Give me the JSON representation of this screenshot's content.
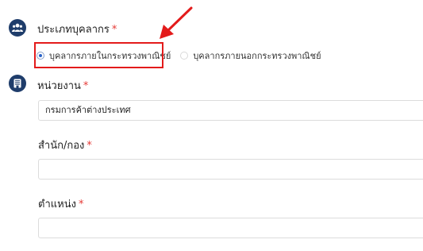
{
  "personnel_type": {
    "label": "ประเภทบุคลากร",
    "required_mark": "*",
    "options": [
      {
        "label": "บุคลากรภายในกระทรวงพาณิชย์",
        "selected": true
      },
      {
        "label": "บุคลากรภายนอกกระทรวงพาณิชย์",
        "selected": false
      }
    ]
  },
  "agency": {
    "label": "หน่วยงาน",
    "required_mark": "*",
    "value": "กรมการค้าต่างประเทศ"
  },
  "office": {
    "label": "สำนัก/กอง",
    "required_mark": "*",
    "value": ""
  },
  "position": {
    "label": "ตำแหน่ง",
    "required_mark": "*",
    "value": ""
  },
  "colors": {
    "icon_bg": "#1f3d6b",
    "highlight": "#e31b1b",
    "required": "#e53935",
    "radio_dot": "#2a63c8"
  },
  "icons": [
    "users-icon",
    "building-icon",
    "red-arrow-annotation"
  ]
}
